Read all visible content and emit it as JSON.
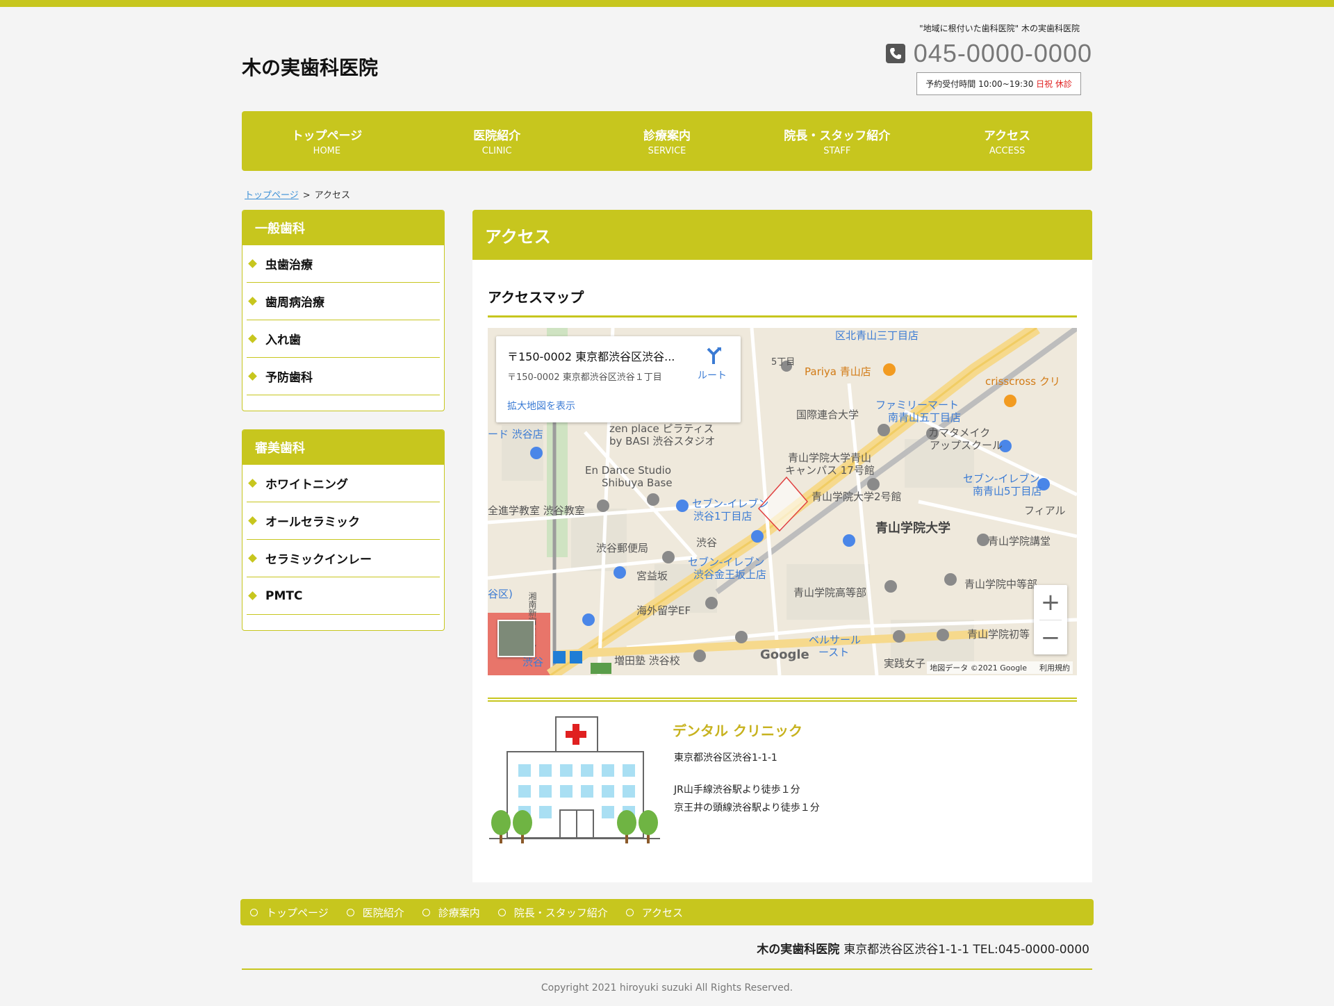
{
  "header": {
    "site_title": "木の実歯科医院",
    "tagline": "\"地域に根付いた歯科医院\" 木の実歯科医院",
    "phone": "045-0000-0000",
    "hours_text": "予約受付時間 10:00~19:30",
    "closed_text": "日祝 休診"
  },
  "nav": [
    {
      "jp": "トップページ",
      "en": "HOME"
    },
    {
      "jp": "医院紹介",
      "en": "CLINIC"
    },
    {
      "jp": "診療案内",
      "en": "SERVICE"
    },
    {
      "jp": "院長・スタッフ紹介",
      "en": "STAFF"
    },
    {
      "jp": "アクセス",
      "en": "ACCESS"
    }
  ],
  "breadcrumb": {
    "home": "トップページ",
    "sep": ">",
    "current": "アクセス"
  },
  "sidebar": {
    "general": {
      "title": "一般歯科",
      "items": [
        "虫歯治療",
        "歯周病治療",
        "入れ歯",
        "予防歯科"
      ]
    },
    "cosmetic": {
      "title": "審美歯科",
      "items": [
        "ホワイトニング",
        "オールセラミック",
        "セラミックインレー",
        "PMTC"
      ]
    }
  },
  "main": {
    "title": "アクセス",
    "section_title": "アクセスマップ"
  },
  "map": {
    "info_title": "〒150-0002 東京都渋谷区渋谷...",
    "info_address": "〒150-0002 東京都渋谷区渋谷１丁目",
    "route_label": "ルート",
    "enlarge_link": "拡大地図を表示",
    "zoom_in": "+",
    "zoom_out": "−",
    "google": "Google",
    "map_data": "地図データ ©2021 Google",
    "terms": "利用規約",
    "labels": {
      "l1": "区北青山三丁目店",
      "l2": "Pariya 青山店",
      "l3": "crisscross クリ",
      "l4": "国際連合大学",
      "l5": "ファミリーマート",
      "l6": "南青山五丁目店",
      "l7": "カマタメイク",
      "l8": "アップスクール",
      "l9": "zen place ピラティス",
      "l10": "by BASI 渋谷スタジオ",
      "l11": "ード 渋谷店",
      "l12": "青山学院大学青山",
      "l13": "キャンパス 17号館",
      "l14": "En Dance Studio",
      "l15": "Shibuya Base",
      "l16": "セブン-イレブン",
      "l17": "南青山5丁目店",
      "l18": "青山学院大学2号館",
      "l19": "全進学教室 渋谷教室",
      "l20": "セブン-イレブン",
      "l21": "渋谷1丁目店",
      "l22": "フィアル",
      "l23": "青山学院大学",
      "l24": "青山学院講堂",
      "l25": "渋谷郵便局",
      "l26": "渋谷",
      "l27": "宮益坂",
      "l28": "セブン-イレブン",
      "l29": "渋谷金王坂上店",
      "l30": "青山学院高等部",
      "l31": "青山学院中等部",
      "l32": "海外留学EF",
      "l33": "ベルサール",
      "l34": "ースト",
      "l35": "青山学院初等",
      "l36": "増田塾 渋谷校",
      "l37": "実践女子",
      "l38": "渋谷",
      "l39": "5丁目",
      "l40": "湘南新宿ライン",
      "l41": "谷区)"
    }
  },
  "clinic": {
    "name": "デンタル クリニック",
    "address": "東京都渋谷区渋谷1-1-1",
    "access1": "JR山手線渋谷駅より徒歩１分",
    "access2": "京王井の頭線渋谷駅より徒歩１分"
  },
  "footer": {
    "nav": [
      "トップページ",
      "医院紹介",
      "診療案内",
      "院長・スタッフ紹介",
      "アクセス"
    ],
    "name": "木の実歯科医院",
    "address": "東京都渋谷区渋谷1-1-1 TEL:045-0000-0000",
    "copyright": "Copyright 2021 hiroyuki suzuki All Rights Reserved."
  },
  "colors": {
    "accent": "#c7c61e",
    "background": "#f4f4f4",
    "link": "#3a8fd6",
    "closed": "#e02020"
  }
}
